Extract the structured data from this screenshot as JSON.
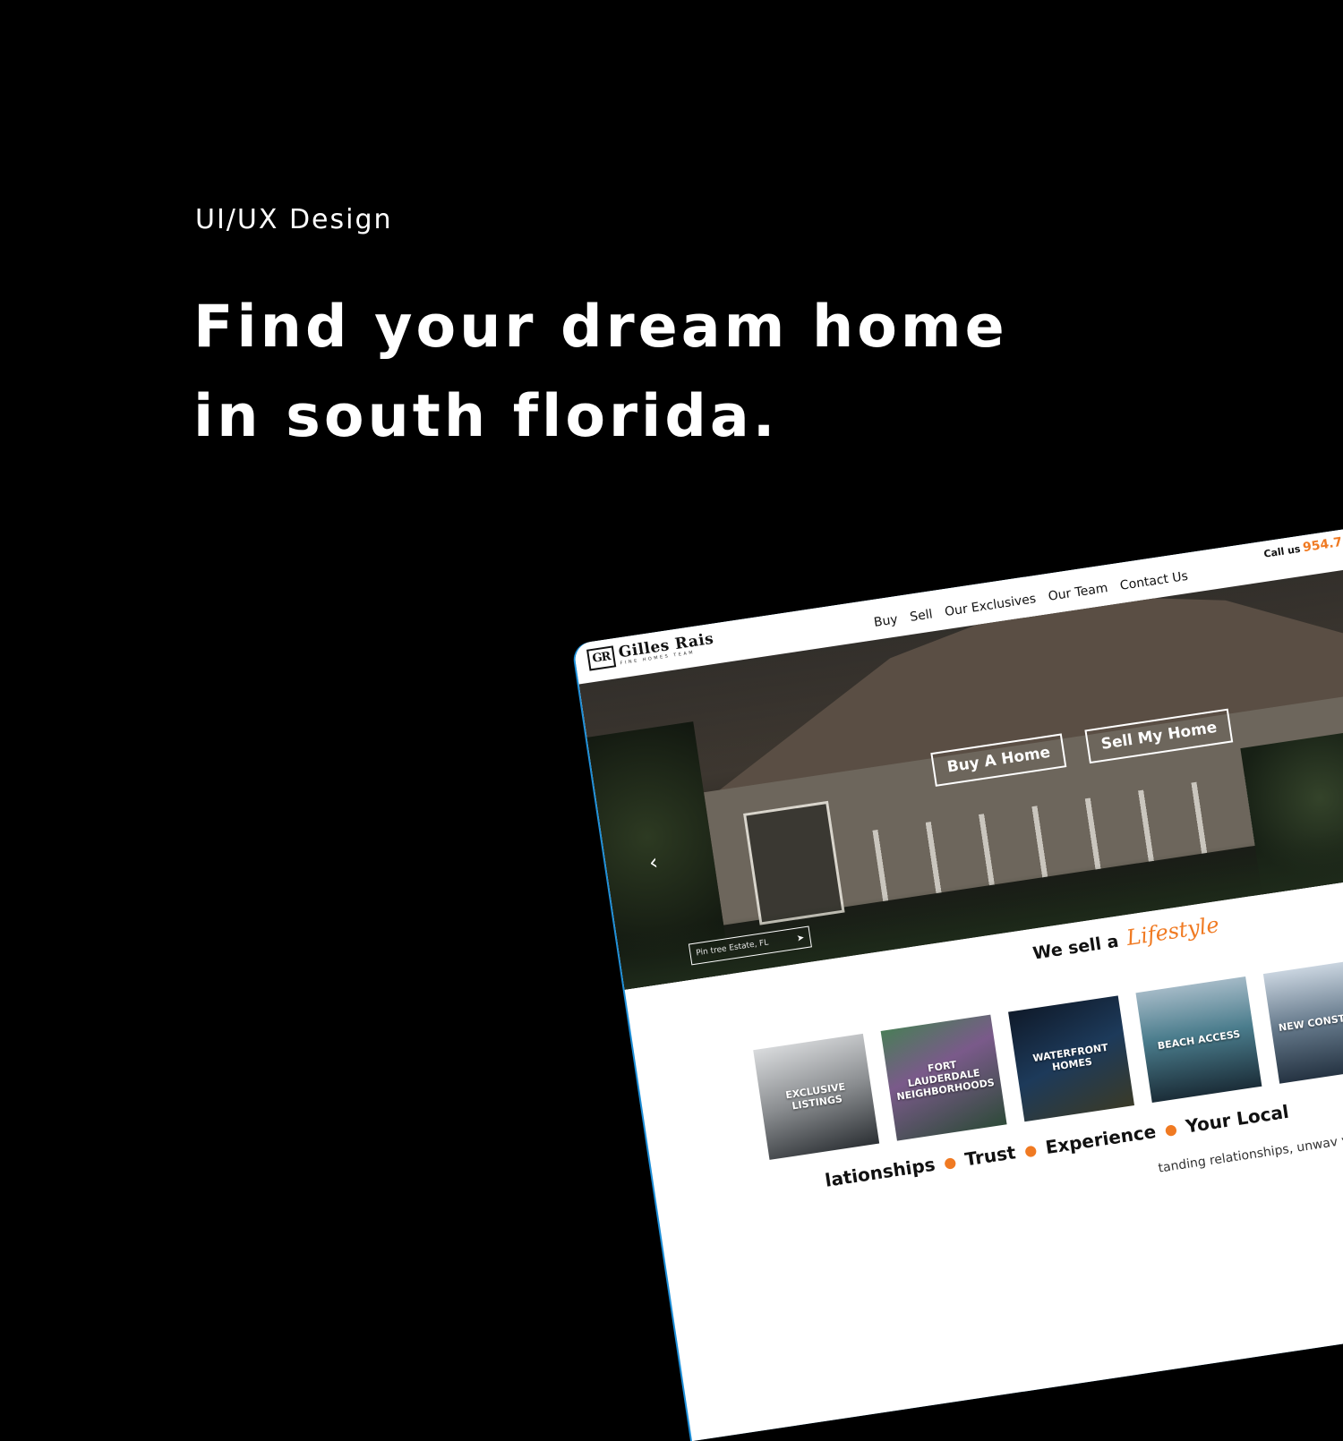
{
  "intro": {
    "eyebrow": "UI/UX Design",
    "headline_line1": "Find your dream home",
    "headline_line2": "in south florida."
  },
  "site": {
    "brand": {
      "name": "Gilles Rais",
      "monogram": "GR",
      "tagline": "FINE HOMES TEAM"
    },
    "nav": [
      "Buy",
      "Sell",
      "Our Exclusives",
      "Our Team",
      "Contact Us"
    ],
    "call_label": "Call us",
    "phone": "954.7",
    "hero": {
      "primary_button": "Buy A Home",
      "secondary_button": "Sell My Home",
      "search_placeholder": "Pin tree Estate, FL"
    },
    "lifestyle": {
      "prefix": "We sell a",
      "script": "Lifestyle"
    },
    "categories": [
      {
        "label": "EXCLUSIVE LISTINGS"
      },
      {
        "label": "FORT LAUDERDALE NEIGHBORHOODS"
      },
      {
        "label": "WATERFRONT HOMES"
      },
      {
        "label": "BEACH ACCESS"
      },
      {
        "label": "NEW CONSTRUCT"
      }
    ],
    "values": [
      "lationships",
      "Trust",
      "Experience",
      "Your Local"
    ],
    "body_text": "tanding relationships, unwav ys you can be as ma"
  },
  "colors": {
    "accent": "#f07a22",
    "background": "#000000",
    "frame_edge": "#1e8fd8"
  }
}
